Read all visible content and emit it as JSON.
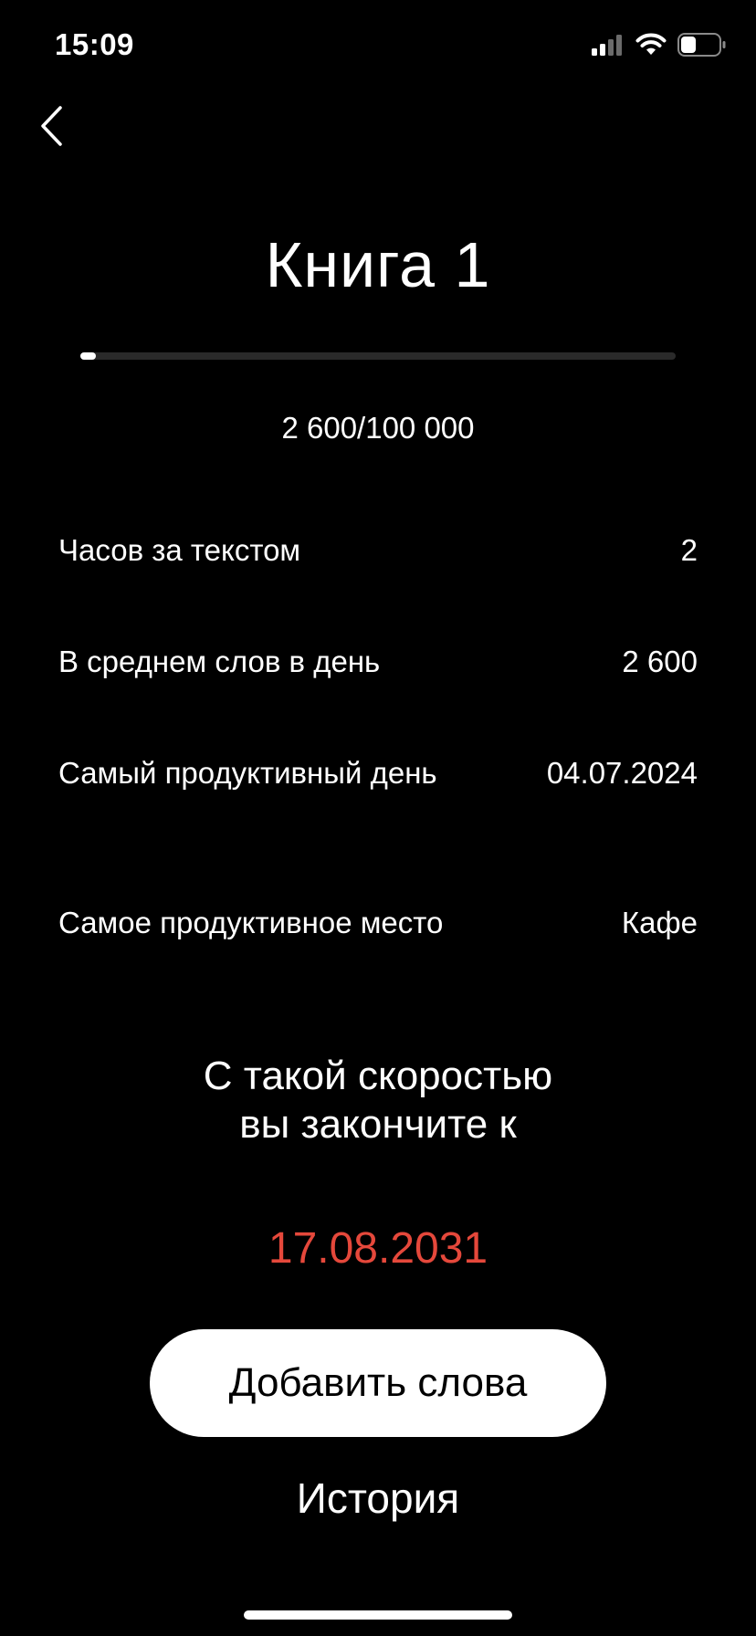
{
  "status_bar": {
    "time": "15:09",
    "icons": [
      "signal-icon",
      "wifi-icon",
      "battery-icon"
    ],
    "battery_level": 0.4
  },
  "header": {
    "back_icon": "chevron-left-icon",
    "title": "Книга 1"
  },
  "progress": {
    "current": 2600,
    "goal": 100000,
    "fraction": 0.026,
    "label": "2 600/100 000"
  },
  "stats": [
    {
      "label": "Часов за текстом",
      "value": "2"
    },
    {
      "label": "В среднем слов в день",
      "value": "2 600"
    },
    {
      "label": "Самый продуктивный день",
      "value": "04.07.2024"
    },
    {
      "label": "Самое продуктивное место",
      "value": "Кафе"
    }
  ],
  "prediction": {
    "line1": "С такой скоростью",
    "line2": "вы закончите к",
    "date": "17.08.2031"
  },
  "actions": {
    "add_words_label": "Добавить слова",
    "history_label": "История"
  },
  "colors": {
    "background": "#000000",
    "text": "#ffffff",
    "accent_date": "#e5483b",
    "progress_track": "#2a2a2a"
  }
}
